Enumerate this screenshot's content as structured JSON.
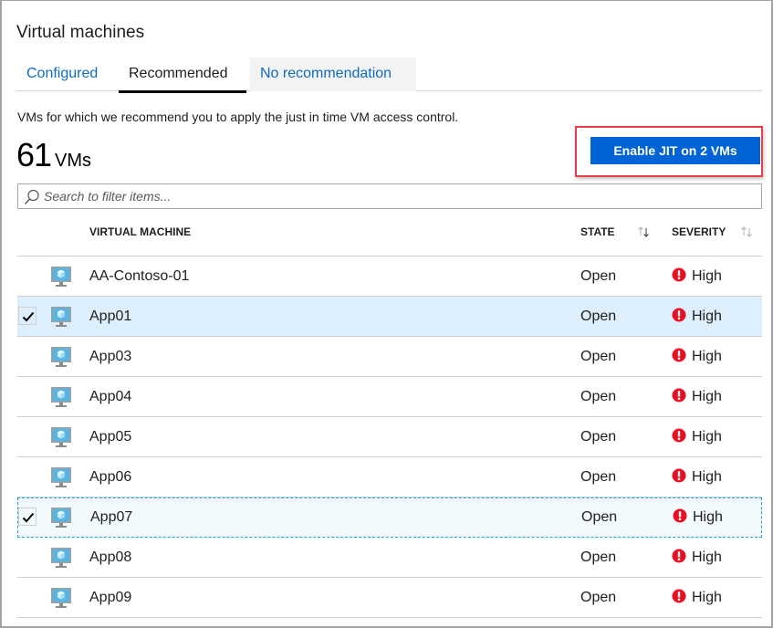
{
  "title": "Virtual machines",
  "tabs": [
    {
      "label": "Configured",
      "state": "normal"
    },
    {
      "label": "Recommended",
      "state": "active"
    },
    {
      "label": "No recommendation",
      "state": "hover"
    }
  ],
  "description": "VMs for which we recommend you to apply the just in time VM access control.",
  "summary": {
    "count": "61",
    "unit": "VMs"
  },
  "enable_button": {
    "label": "Enable JIT on 2 VMs",
    "background": "#0064d6",
    "highlight_color": "#e83d4a"
  },
  "search": {
    "placeholder": "Search to filter items...",
    "value": "",
    "icon": "search-icon"
  },
  "table": {
    "columns": [
      {
        "label": "VIRTUAL MACHINE",
        "sortable": false
      },
      {
        "label": "STATE",
        "sortable": true,
        "sort": "descending"
      },
      {
        "label": "SEVERITY",
        "sortable": true,
        "sort": "none"
      }
    ],
    "rows": [
      {
        "name": "AA-Contoso-01",
        "state": "Open",
        "severity": "High",
        "checked": false,
        "selected": false,
        "focused": false
      },
      {
        "name": "App01",
        "state": "Open",
        "severity": "High",
        "checked": true,
        "selected": true,
        "focused": false
      },
      {
        "name": "App03",
        "state": "Open",
        "severity": "High",
        "checked": false,
        "selected": false,
        "focused": false
      },
      {
        "name": "App04",
        "state": "Open",
        "severity": "High",
        "checked": false,
        "selected": false,
        "focused": false
      },
      {
        "name": "App05",
        "state": "Open",
        "severity": "High",
        "checked": false,
        "selected": false,
        "focused": false
      },
      {
        "name": "App06",
        "state": "Open",
        "severity": "High",
        "checked": false,
        "selected": false,
        "focused": false
      },
      {
        "name": "App07",
        "state": "Open",
        "severity": "High",
        "checked": true,
        "selected": false,
        "focused": true
      },
      {
        "name": "App08",
        "state": "Open",
        "severity": "High",
        "checked": false,
        "selected": false,
        "focused": false
      },
      {
        "name": "App09",
        "state": "Open",
        "severity": "High",
        "checked": false,
        "selected": false,
        "focused": false
      }
    ],
    "severity_color": "#e81123",
    "vm_icon": "virtual-machine-icon",
    "severity_icon": "error-icon"
  }
}
